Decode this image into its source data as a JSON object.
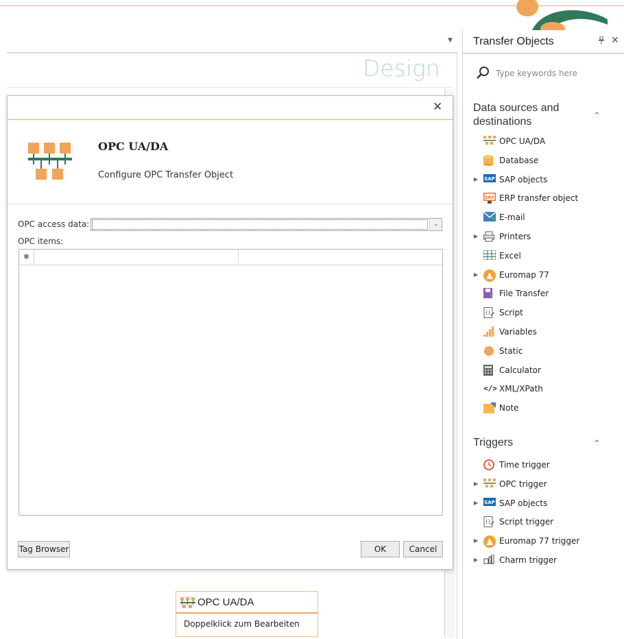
{
  "dialog": {
    "title": "OPC UA/DA",
    "subtitle": "Configure OPC Transfer Object",
    "access_label": "OPC access data:",
    "access_value": "",
    "items_label": "OPC items:",
    "new_row_symbol": "✱",
    "tag_browser_label": "Tag Browser",
    "ok_label": "OK",
    "cancel_label": "Cancel",
    "close_glyph": "✕"
  },
  "design": {
    "title": "Design",
    "dropdown_glyph": "▼"
  },
  "node": {
    "title": "OPC UA/DA",
    "subtitle": "Doppelklick zum Bearbeiten"
  },
  "panel": {
    "title": "Transfer Objects",
    "pin_glyph": "📌",
    "close_glyph": "✕",
    "search_placeholder": "Type keywords here",
    "sections": [
      {
        "title": "Data sources and destinations",
        "items": [
          {
            "label": "OPC UA/DA",
            "icon": "opc-icon",
            "expandable": false
          },
          {
            "label": "Database",
            "icon": "database-icon",
            "expandable": false
          },
          {
            "label": "SAP objects",
            "icon": "sap-icon",
            "expandable": true
          },
          {
            "label": "ERP transfer object",
            "icon": "erp-icon",
            "expandable": false
          },
          {
            "label": "E-mail",
            "icon": "email-icon",
            "expandable": false
          },
          {
            "label": "Printers",
            "icon": "printer-icon",
            "expandable": true
          },
          {
            "label": "Excel",
            "icon": "excel-icon",
            "expandable": false
          },
          {
            "label": "Euromap 77",
            "icon": "euromap-icon",
            "expandable": true
          },
          {
            "label": "File Transfer",
            "icon": "file-transfer-icon",
            "expandable": false
          },
          {
            "label": "Script",
            "icon": "script-icon",
            "expandable": false
          },
          {
            "label": "Variables",
            "icon": "variables-icon",
            "expandable": false
          },
          {
            "label": "Static",
            "icon": "static-icon",
            "expandable": false
          },
          {
            "label": "Calculator",
            "icon": "calculator-icon",
            "expandable": false
          },
          {
            "label": "XML/XPath",
            "icon": "xml-icon",
            "expandable": false
          },
          {
            "label": "Note",
            "icon": "note-icon",
            "expandable": false
          }
        ]
      },
      {
        "title": "Triggers",
        "items": [
          {
            "label": "Time trigger",
            "icon": "clock-icon",
            "expandable": false
          },
          {
            "label": "OPC trigger",
            "icon": "opc-icon",
            "expandable": true
          },
          {
            "label": "SAP objects",
            "icon": "sap-icon",
            "expandable": true
          },
          {
            "label": "Script trigger",
            "icon": "script-icon",
            "expandable": false
          },
          {
            "label": "Euromap 77 trigger",
            "icon": "euromap-icon",
            "expandable": true
          },
          {
            "label": "Charm trigger",
            "icon": "charm-icon",
            "expandable": true
          }
        ]
      }
    ]
  },
  "colors": {
    "accent_orange": "#f0a55a",
    "design_title": "#b7ddc9",
    "logo_green": "#2e7a5a"
  }
}
